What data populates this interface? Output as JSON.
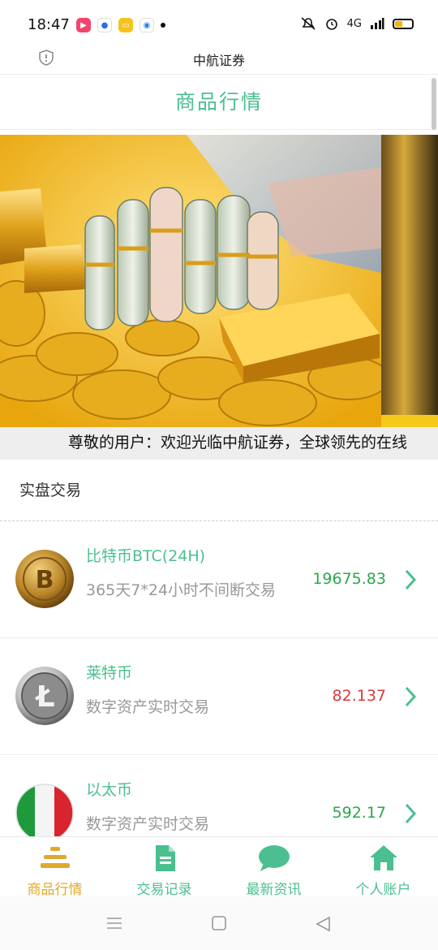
{
  "status": {
    "time": "18:47",
    "network": "4G",
    "accent_battery": "#f5b400"
  },
  "browser": {
    "title": "中航证券"
  },
  "header": {
    "title": "商品行情"
  },
  "marquee": {
    "text": "尊敬的用户：欢迎光临中航证券，全球领先的在线"
  },
  "section": {
    "title": "实盘交易"
  },
  "coins": [
    {
      "name": "比特币BTC(24H)",
      "desc": "365天7*24小时不间断交易",
      "price": "19675.83",
      "price_color": "#2aa84a",
      "icon": "bitcoin-coin-icon"
    },
    {
      "name": "莱特币",
      "desc": "数字资产实时交易",
      "price": "82.137",
      "price_color": "#d83a3a",
      "icon": "litecoin-coin-icon"
    },
    {
      "name": "以太币",
      "desc": "数字资产实时交易",
      "price": "592.17",
      "price_color": "#2aa84a",
      "icon": "italy-flag-icon"
    }
  ],
  "tabs": [
    {
      "label": "商品行情",
      "icon": "list-icon",
      "active": true,
      "color": "#e0a92a"
    },
    {
      "label": "交易记录",
      "icon": "document-icon",
      "active": false,
      "color": "#4bbf8f"
    },
    {
      "label": "最新资讯",
      "icon": "chat-bubble-icon",
      "active": false,
      "color": "#4bbf8f"
    },
    {
      "label": "个人账户",
      "icon": "home-icon",
      "active": false,
      "color": "#4bbf8f"
    }
  ],
  "colors": {
    "accent": "#4bbf8f",
    "active_tab": "#e0a92a"
  }
}
